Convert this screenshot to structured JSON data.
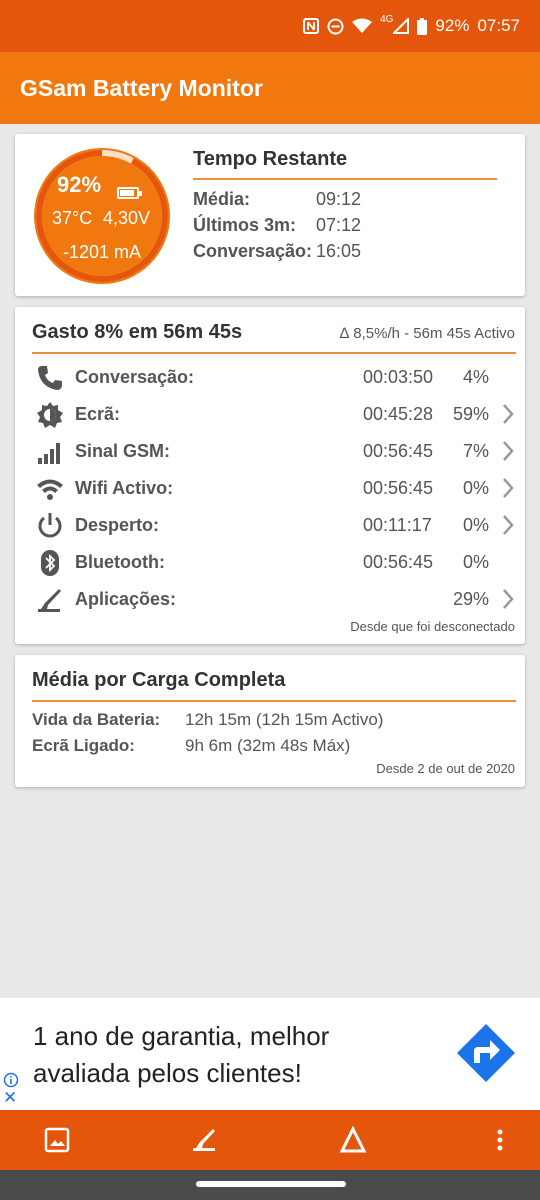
{
  "status_bar": {
    "network_type": "4G",
    "battery_percent": "92%",
    "time": "07:57",
    "icons": [
      "nfc-icon",
      "dnd-icon",
      "wifi-icon",
      "signal-icon",
      "battery-icon"
    ]
  },
  "app_bar": {
    "title": "GSam Battery Monitor"
  },
  "gauge": {
    "percent": "92%",
    "temperature": "37°C",
    "voltage": "4,30V",
    "current": "-1201 mA",
    "level": 0.92,
    "colors": {
      "ring": "#f0780e",
      "track": "#fbe0c8"
    }
  },
  "remaining": {
    "title": "Tempo Restante",
    "rows": [
      {
        "label": "Média:",
        "value": "09:12"
      },
      {
        "label": "Últimos 3m:",
        "value": "07:12"
      },
      {
        "label": "Conversação:",
        "value": "16:05"
      }
    ]
  },
  "usage": {
    "title": "Gasto 8% em 56m 45s",
    "subtitle": "∆ 8,5%/h - 56m 45s Activo",
    "rows": [
      {
        "icon": "phone-icon",
        "label": "Conversação:",
        "time": "00:03:50",
        "percent": "4%",
        "has_chevron": false
      },
      {
        "icon": "screen-brightness-icon",
        "label": "Ecrã:",
        "time": "00:45:28",
        "percent": "59%",
        "has_chevron": true
      },
      {
        "icon": "cell-signal-icon",
        "label": "Sinal GSM:",
        "time": "00:56:45",
        "percent": "7%",
        "has_chevron": true
      },
      {
        "icon": "wifi-icon",
        "label": "Wifi Activo:",
        "time": "00:56:45",
        "percent": "0%",
        "has_chevron": true
      },
      {
        "icon": "power-icon",
        "label": "Desperto:",
        "time": "00:11:17",
        "percent": "0%",
        "has_chevron": true
      },
      {
        "icon": "bluetooth-icon",
        "label": "Bluetooth:",
        "time": "00:56:45",
        "percent": "0%",
        "has_chevron": false
      },
      {
        "icon": "apps-icon",
        "label": "Aplicações:",
        "time": "",
        "percent": "29%",
        "has_chevron": true
      }
    ],
    "footer": "Desde que foi desconectado"
  },
  "full_charge": {
    "title": "Média por Carga Completa",
    "rows": [
      {
        "label": "Vida da Bateria:",
        "value": "12h 15m (12h 15m Activo)"
      },
      {
        "label": "Ecrã Ligado:",
        "value": "9h 6m (32m 48s Máx)"
      }
    ],
    "footer": "Desde 2 de out de 2020"
  },
  "ad": {
    "text": "1 ano de garantia, melhor avaliada pelos clientes!",
    "icons": [
      "info-icon",
      "close-icon",
      "directions-arrow-icon"
    ]
  },
  "bottom_bar": {
    "buttons": [
      "image-icon",
      "apps-icon",
      "delta-icon",
      "more-vert-icon"
    ]
  },
  "colors": {
    "status_bar": "#e4560c",
    "app_bar": "#f0780e",
    "accent_rule": "#e8913e",
    "bottom_bar": "#e4560c",
    "ad_blue": "#1a73e8"
  }
}
